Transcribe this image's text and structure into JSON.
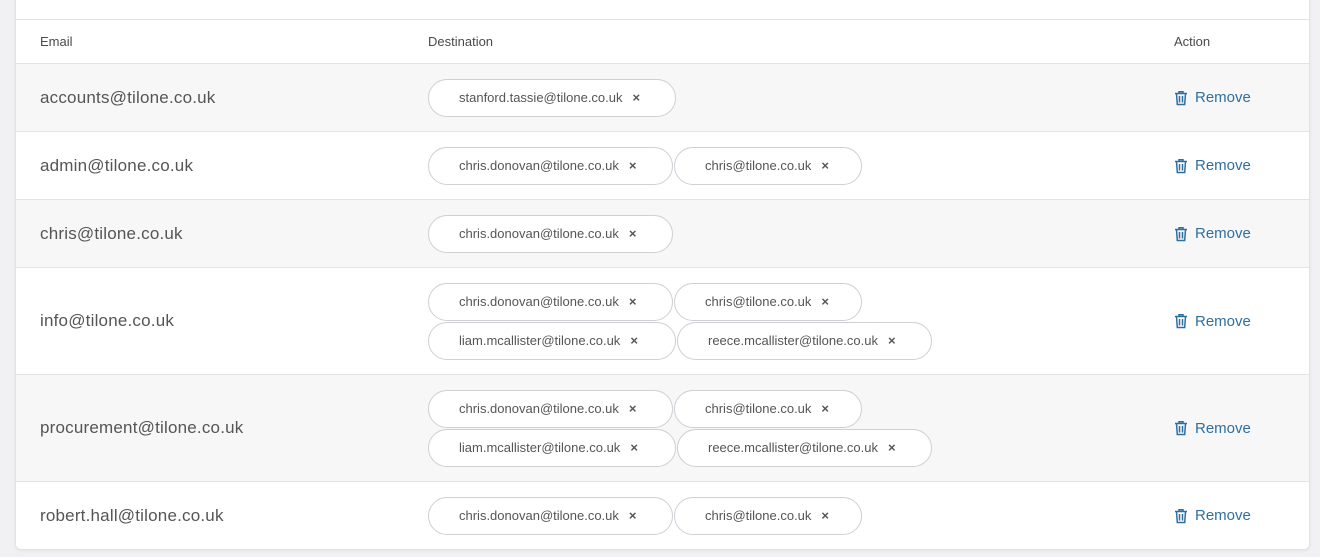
{
  "table": {
    "headers": {
      "email": "Email",
      "destination": "Destination",
      "action": "Action"
    },
    "remove_label": "Remove",
    "remove_icon": "trash-icon",
    "chip_remove_glyph": "×",
    "rows": [
      {
        "email": "accounts@tilone.co.uk",
        "destinations": [
          "stanford.tassie@tilone.co.uk"
        ]
      },
      {
        "email": "admin@tilone.co.uk",
        "destinations": [
          "chris.donovan@tilone.co.uk",
          "chris@tilone.co.uk"
        ]
      },
      {
        "email": "chris@tilone.co.uk",
        "destinations": [
          "chris.donovan@tilone.co.uk"
        ]
      },
      {
        "email": "info@tilone.co.uk",
        "destinations": [
          "chris.donovan@tilone.co.uk",
          "chris@tilone.co.uk",
          "liam.mcallister@tilone.co.uk",
          "reece.mcallister@tilone.co.uk"
        ]
      },
      {
        "email": "procurement@tilone.co.uk",
        "destinations": [
          "chris.donovan@tilone.co.uk",
          "chris@tilone.co.uk",
          "liam.mcallister@tilone.co.uk",
          "reece.mcallister@tilone.co.uk"
        ]
      },
      {
        "email": "robert.hall@tilone.co.uk",
        "destinations": [
          "chris.donovan@tilone.co.uk",
          "chris@tilone.co.uk"
        ]
      }
    ]
  },
  "colors": {
    "action_link": "#2f6f9e",
    "row_alt_bg": "#f7f7f8",
    "border": "#e3e3e6"
  }
}
